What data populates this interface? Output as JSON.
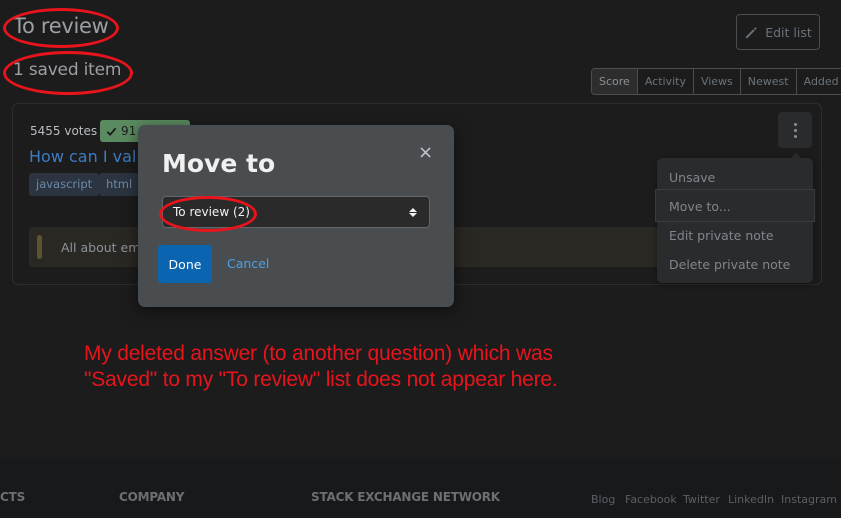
{
  "header": {
    "title": "To review",
    "saved_count": "1 saved item",
    "edit_button_label": "Edit list",
    "edit_icon": "pencil-icon"
  },
  "sort_tabs": [
    {
      "label": "Score",
      "active": true
    },
    {
      "label": "Activity",
      "active": false
    },
    {
      "label": "Views",
      "active": false
    },
    {
      "label": "Newest",
      "active": false
    },
    {
      "label": "Added",
      "active": false
    }
  ],
  "item": {
    "votes": "5455 votes",
    "answers_badge": "91",
    "answers_icon": "check-icon",
    "title": "How can I valic",
    "tags": [
      "javascript",
      "html"
    ],
    "private_note": "All about ema",
    "more_icon": "kebab-icon"
  },
  "item_menu": {
    "items": [
      "Unsave",
      "Move to...",
      "Edit private note",
      "Delete private note"
    ],
    "highlighted": "Move to..."
  },
  "modal": {
    "title": "Move to",
    "close_label": "×",
    "select_value": "To review (2)",
    "done_label": "Done",
    "cancel_label": "Cancel"
  },
  "annotation": {
    "line1": "My deleted answer (to another question) which was",
    "line2": "\"Saved\" to my \"To review\" list does not appear here.",
    "color": "#e8141c"
  },
  "footer": {
    "headings": [
      "CTS",
      "COMPANY",
      "STACK EXCHANGE NETWORK"
    ],
    "links": [
      "Blog",
      "Facebook",
      "Twitter",
      "LinkedIn",
      "Instagram"
    ]
  },
  "colors": {
    "background": "#1c1c1c",
    "accent_blue": "#0a64b0",
    "link_blue": "#3d7cc4",
    "accepted_green": "#5a8a5f"
  }
}
